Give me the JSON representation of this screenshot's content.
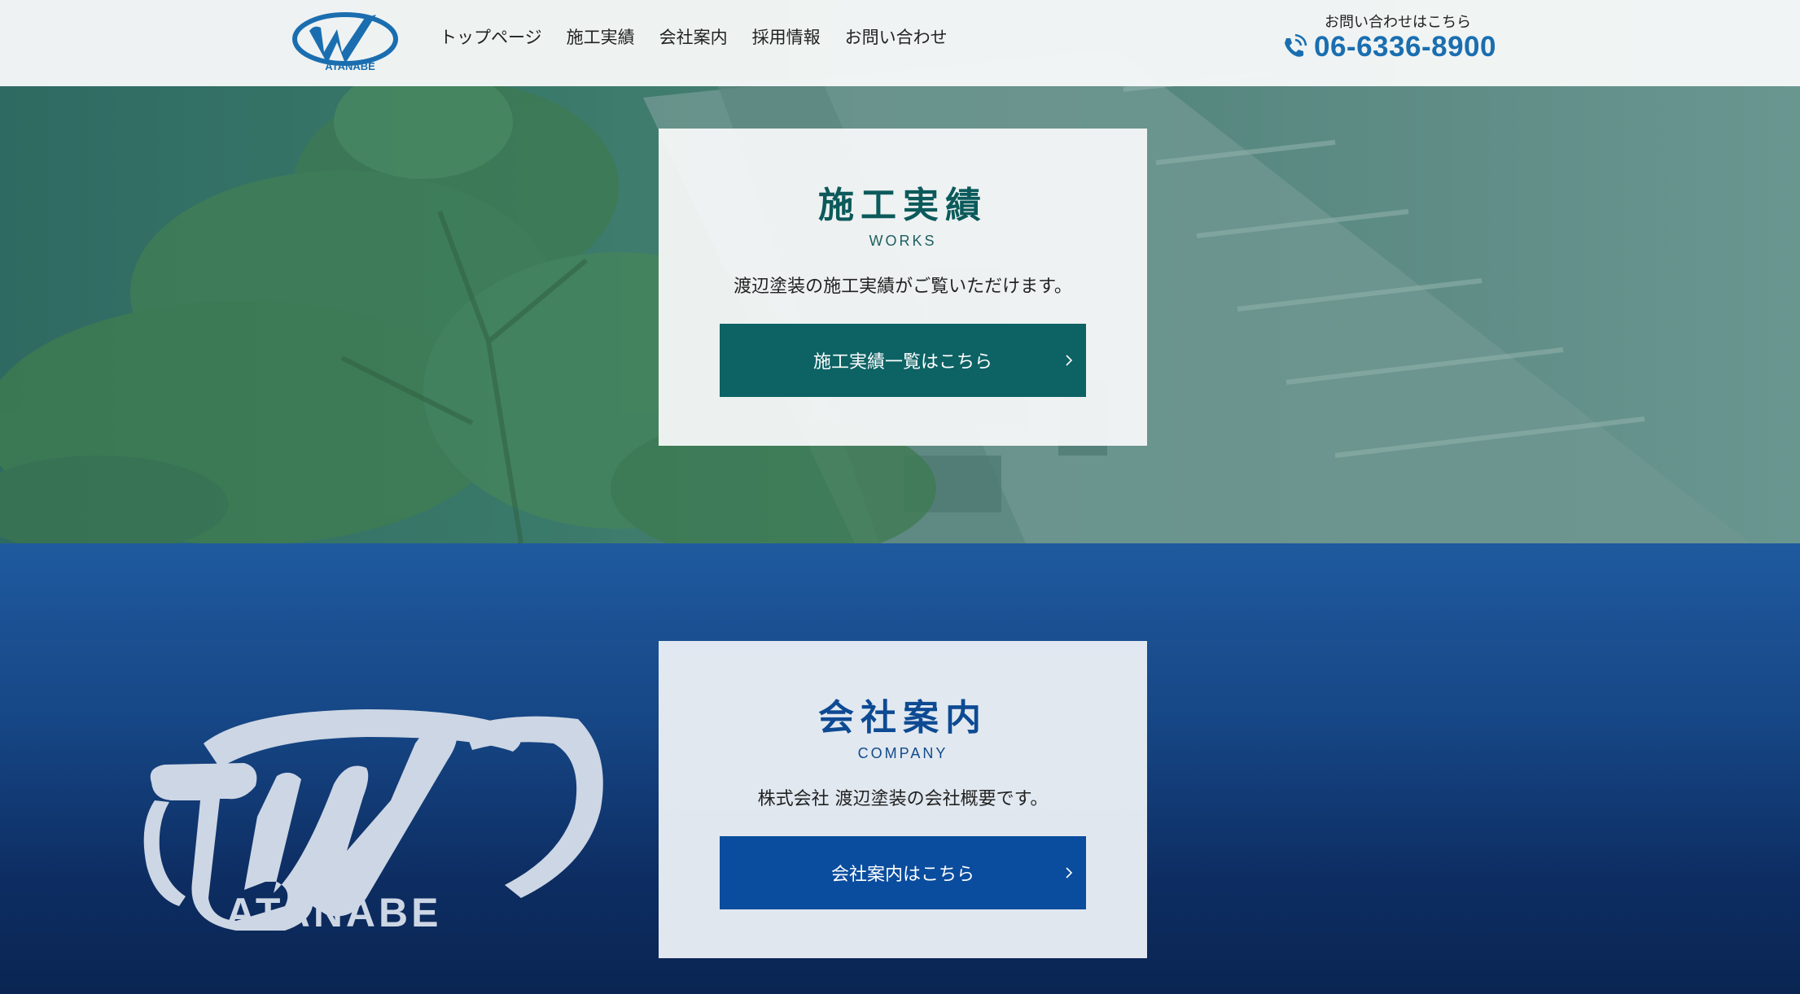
{
  "header": {
    "logo_text": "ATANABE",
    "nav": [
      "トップページ",
      "施工実績",
      "会社案内",
      "採用情報",
      "お問い合わせ"
    ],
    "contact_label": "お問い合わせはこちら",
    "phone": "06-6336-8900"
  },
  "works": {
    "title": "施工実績",
    "subtitle": "WORKS",
    "description": "渡辺塗装の施工実績がご覧いただけます。",
    "button_label": "施工実績一覧はこちら"
  },
  "company": {
    "title": "会社案内",
    "subtitle": "COMPANY",
    "description": "株式会社 渡辺塗装の会社概要です。",
    "button_label": "会社案内はこちら",
    "logo_text": "ATANABE"
  },
  "colors": {
    "brand_blue": "#1a6eb0",
    "works_teal": "#0d6264",
    "company_blue": "#0a4d9e"
  }
}
